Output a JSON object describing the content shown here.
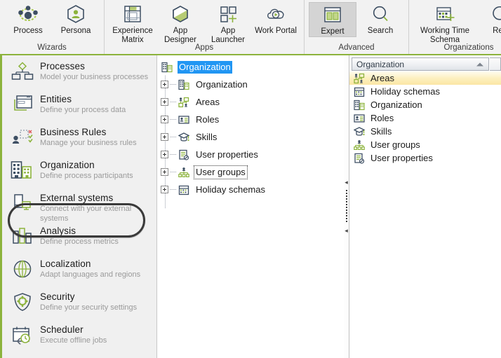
{
  "ribbon": {
    "groups": [
      {
        "name": "wizards",
        "label": "Wizards",
        "items": [
          {
            "label": "Process",
            "icon": "process-network-icon",
            "selected": false
          },
          {
            "label": "Persona",
            "icon": "persona-hexagon-icon",
            "selected": false
          }
        ]
      },
      {
        "name": "apps",
        "label": "Apps",
        "items": [
          {
            "label": "Experience Matrix",
            "icon": "experience-matrix-icon",
            "selected": false
          },
          {
            "label": "App Designer",
            "icon": "app-designer-hexagon-icon",
            "selected": false
          },
          {
            "label": "App Launcher",
            "icon": "app-launcher-squares-icon",
            "selected": false
          },
          {
            "label": "Work Portal",
            "icon": "work-portal-cloud-play-icon",
            "selected": false
          }
        ]
      },
      {
        "name": "advanced",
        "label": "Advanced",
        "items": [
          {
            "label": "Expert",
            "icon": "expert-panels-icon",
            "selected": true
          },
          {
            "label": "Search",
            "icon": "search-magnifier-icon",
            "selected": false
          }
        ]
      },
      {
        "name": "organizations",
        "label": "Organizations",
        "items": [
          {
            "label": "Working Time Schema",
            "icon": "working-time-calendar-icon",
            "selected": false
          },
          {
            "label": "Refr",
            "icon": "refresh-arrow-icon",
            "selected": false
          }
        ]
      }
    ]
  },
  "sidebar": {
    "collapse_icon": "chevron-left-icon",
    "items": [
      {
        "title": "Processes",
        "subtitle": "Model your business processes",
        "icon": "processes-icon",
        "selected": false
      },
      {
        "title": "Entities",
        "subtitle": "Define your process data",
        "icon": "entities-icon",
        "selected": false
      },
      {
        "title": "Business Rules",
        "subtitle": "Manage your business rules",
        "icon": "business-rules-icon",
        "selected": false
      },
      {
        "title": "Organization",
        "subtitle": "Define process participants",
        "icon": "organization-icon",
        "selected": true
      },
      {
        "title": "External systems",
        "subtitle": "Connect with your external systems",
        "icon": "external-systems-icon",
        "selected": false
      },
      {
        "title": "Analysis",
        "subtitle": "Define process metrics",
        "icon": "analysis-icon",
        "selected": false
      },
      {
        "title": "Localization",
        "subtitle": "Adapt languages and regions",
        "icon": "localization-icon",
        "selected": false
      },
      {
        "title": "Security",
        "subtitle": "Define your security settings",
        "icon": "security-icon",
        "selected": false
      },
      {
        "title": "Scheduler",
        "subtitle": "Execute offline jobs",
        "icon": "scheduler-icon",
        "selected": false
      }
    ]
  },
  "tree": {
    "root": {
      "label": "Organization",
      "icon": "organization-building-icon",
      "selected": true
    },
    "nodes": [
      {
        "label": "Organization",
        "icon": "organization-building-icon",
        "expander": "plus",
        "focused": false
      },
      {
        "label": "Areas",
        "icon": "areas-icon",
        "expander": "plus",
        "focused": false
      },
      {
        "label": "Roles",
        "icon": "roles-card-icon",
        "expander": "plus",
        "focused": false
      },
      {
        "label": "Skills",
        "icon": "skills-cap-icon",
        "expander": "plus",
        "focused": false
      },
      {
        "label": "User properties",
        "icon": "user-properties-icon",
        "expander": "plus",
        "focused": false
      },
      {
        "label": "User groups",
        "icon": "user-groups-icon",
        "expander": "plus",
        "focused": true
      },
      {
        "label": "Holiday schemas",
        "icon": "holiday-schemas-icon",
        "expander": "plus",
        "focused": false
      }
    ]
  },
  "splitter": {
    "collapse_up_icon": "triangle-left-icon",
    "collapse_down_icon": "triangle-left-icon"
  },
  "right_panel": {
    "header": {
      "title": "Organization",
      "collapse_icon": "chevron-up-icon"
    },
    "items": [
      {
        "label": "Areas",
        "icon": "areas-icon",
        "highlighted": true
      },
      {
        "label": "Holiday schemas",
        "icon": "holiday-schemas-icon",
        "highlighted": false
      },
      {
        "label": "Organization",
        "icon": "organization-building-icon",
        "highlighted": false
      },
      {
        "label": "Roles",
        "icon": "roles-card-icon",
        "highlighted": false
      },
      {
        "label": "Skills",
        "icon": "skills-cap-icon",
        "highlighted": false
      },
      {
        "label": "User groups",
        "icon": "user-groups-icon",
        "highlighted": false
      },
      {
        "label": "User properties",
        "icon": "user-properties-icon",
        "highlighted": false
      }
    ]
  },
  "colors": {
    "accent_green": "#8cb33c",
    "icon_navy": "#3e4f63",
    "selection_blue": "#2196f3",
    "row_highlight": "#fbe6a4",
    "ribbon_bg": "#f2f2f2",
    "sidebar_bg": "#f0f0f0"
  }
}
